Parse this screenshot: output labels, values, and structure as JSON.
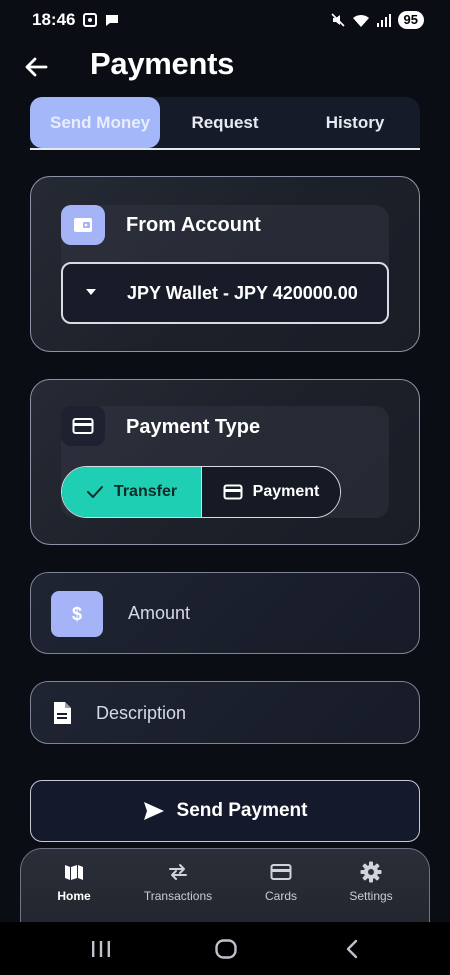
{
  "status_bar": {
    "time": "18:46",
    "battery": "95"
  },
  "header": {
    "title": "Payments"
  },
  "tabs": [
    {
      "label": "Send Money"
    },
    {
      "label": "Request"
    },
    {
      "label": "History"
    }
  ],
  "from_account": {
    "label": "From Account",
    "selected_account": "JPY Wallet - JPY 420000.00"
  },
  "payment_type": {
    "label": "Payment Type",
    "options": [
      {
        "label": "Transfer",
        "selected": true
      },
      {
        "label": "Payment",
        "selected": false
      }
    ]
  },
  "amount": {
    "icon_text": "$",
    "placeholder": "Amount"
  },
  "description": {
    "placeholder": "Description"
  },
  "send_button": {
    "label": "Send Payment"
  },
  "bottom_nav": [
    {
      "label": "Home",
      "active": true
    },
    {
      "label": "Transactions",
      "active": false
    },
    {
      "label": "Cards",
      "active": false
    },
    {
      "label": "Settings",
      "active": false
    }
  ],
  "colors": {
    "accent": "#a4b4f6",
    "success": "#1ecfb3",
    "background": "#0b0d14"
  }
}
